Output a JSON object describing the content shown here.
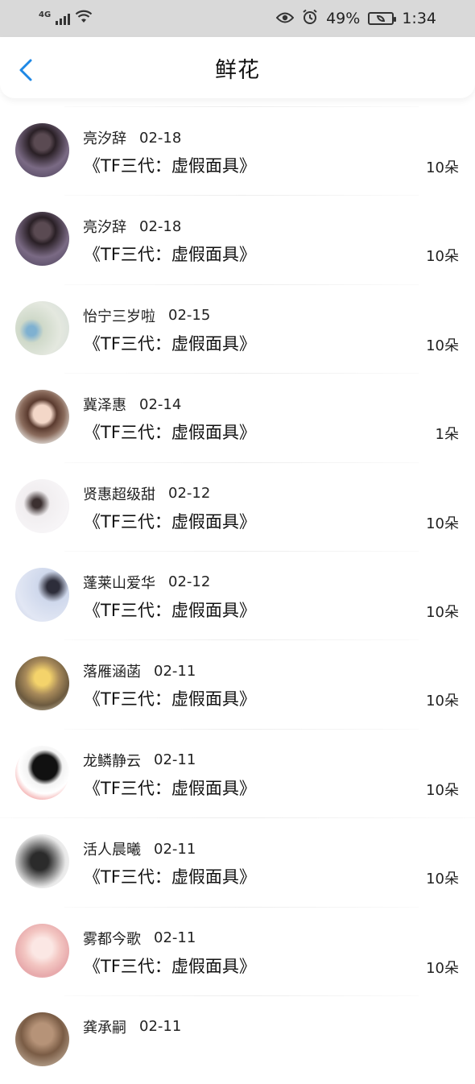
{
  "status_bar": {
    "network": "4G",
    "battery_percent": "49%",
    "time": "1:34",
    "icons": [
      "signal-icon",
      "wifi-icon",
      "eye-icon",
      "alarm-icon",
      "battery-icon"
    ]
  },
  "header": {
    "back_icon": "chevron-left-icon",
    "title": "鲜花"
  },
  "colors": {
    "accent": "#1e88e5",
    "status_bar_bg": "#d9d9d9"
  },
  "list": [
    {
      "name": "亮汐辞",
      "date": "02-18",
      "work": "《TF三代：虚假面具》",
      "count": "10朵"
    },
    {
      "name": "亮汐辞",
      "date": "02-18",
      "work": "《TF三代：虚假面具》",
      "count": "10朵"
    },
    {
      "name": "怡宁三岁啦",
      "date": "02-15",
      "work": "《TF三代：虚假面具》",
      "count": "10朵"
    },
    {
      "name": "冀泽惠",
      "date": "02-14",
      "work": "《TF三代：虚假面具》",
      "count": "1朵"
    },
    {
      "name": "贤惠超级甜",
      "date": "02-12",
      "work": "《TF三代：虚假面具》",
      "count": "10朵"
    },
    {
      "name": "蓬莱山爱华",
      "date": "02-12",
      "work": "《TF三代：虚假面具》",
      "count": "10朵"
    },
    {
      "name": "落雁涵菡",
      "date": "02-11",
      "work": "《TF三代：虚假面具》",
      "count": "10朵"
    },
    {
      "name": "龙鳞静云",
      "date": "02-11",
      "work": "《TF三代：虚假面具》",
      "count": "10朵"
    },
    {
      "name": "活人晨曦",
      "date": "02-11",
      "work": "《TF三代：虚假面具》",
      "count": "10朵"
    },
    {
      "name": "雾都今歌",
      "date": "02-11",
      "work": "《TF三代：虚假面具》",
      "count": "10朵"
    },
    {
      "name": "龚承嗣",
      "date": "02-11",
      "work": "",
      "count": ""
    }
  ]
}
